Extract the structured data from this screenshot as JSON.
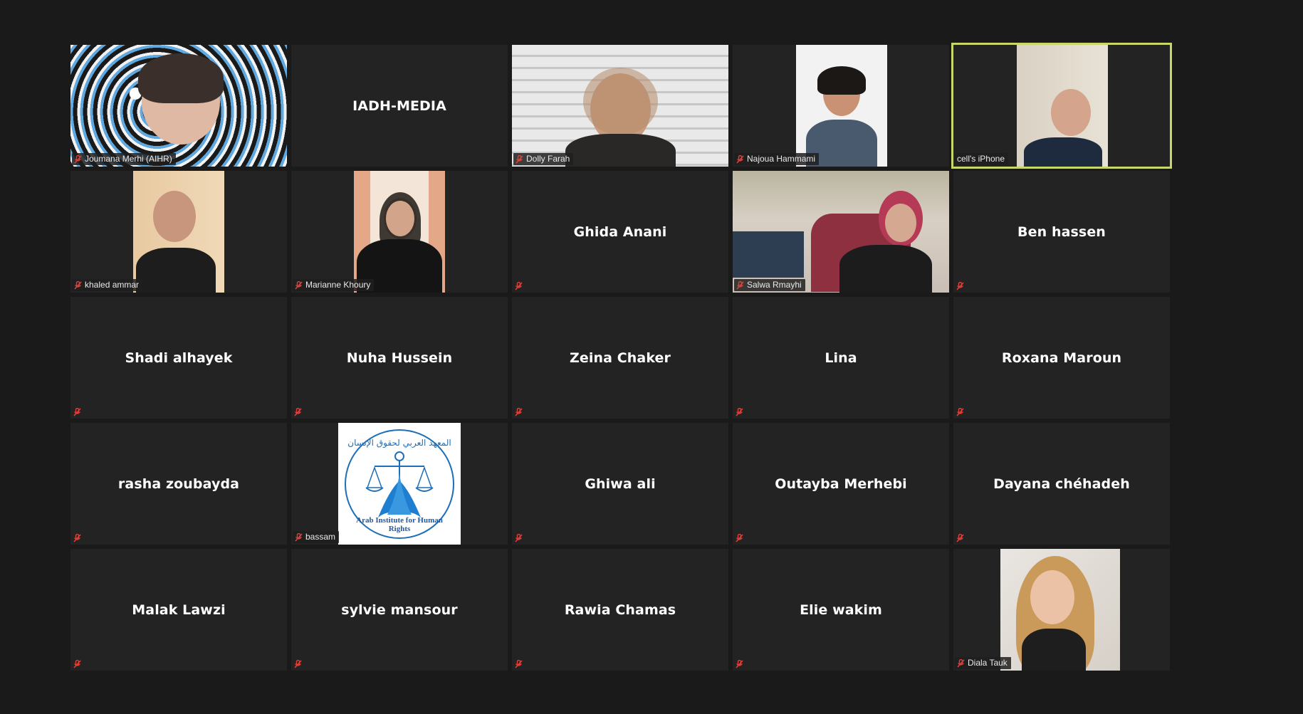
{
  "meeting": {
    "view": "gallery",
    "colors": {
      "background": "#1a1a1a",
      "tile": "#232323",
      "active_speaker_border": "#c8d66a",
      "muted_icon": "#e0403a"
    }
  },
  "participants": [
    {
      "name": "Joumana Merhi (AIHR)",
      "video": true,
      "muted": true,
      "active": false
    },
    {
      "name": "IADH-MEDIA",
      "video": false,
      "muted": false,
      "active": false
    },
    {
      "name": "Dolly Farah",
      "video": true,
      "muted": true,
      "active": false
    },
    {
      "name": "Najoua Hammami",
      "video": true,
      "muted": true,
      "active": false
    },
    {
      "name": "cell's iPhone",
      "video": true,
      "muted": false,
      "active": true
    },
    {
      "name": "khaled ammar",
      "video": true,
      "muted": true,
      "active": false
    },
    {
      "name": "Marianne Khoury",
      "video": true,
      "muted": true,
      "active": false
    },
    {
      "name": "Ghida Anani",
      "video": false,
      "muted": true,
      "active": false
    },
    {
      "name": "Salwa Rmayhi",
      "video": true,
      "muted": true,
      "active": false
    },
    {
      "name": "Ben hassen",
      "video": false,
      "muted": true,
      "active": false
    },
    {
      "name": "Shadi alhayek",
      "video": false,
      "muted": true,
      "active": false
    },
    {
      "name": "Nuha Hussein",
      "video": false,
      "muted": true,
      "active": false
    },
    {
      "name": "Zeina Chaker",
      "video": false,
      "muted": true,
      "active": false
    },
    {
      "name": "Lina",
      "video": false,
      "muted": true,
      "active": false
    },
    {
      "name": "Roxana Maroun",
      "video": false,
      "muted": true,
      "active": false
    },
    {
      "name": "rasha zoubayda",
      "video": false,
      "muted": true,
      "active": false
    },
    {
      "name": "bassam",
      "video": true,
      "muted": true,
      "active": false,
      "logo_text": "Arab Institute for Human Rights",
      "logo_arabic": "المعهد العربي لحقوق الإنسان"
    },
    {
      "name": "Ghiwa ali",
      "video": false,
      "muted": true,
      "active": false
    },
    {
      "name": "Outayba Merhebi",
      "video": false,
      "muted": true,
      "active": false
    },
    {
      "name": "Dayana chéhadeh",
      "video": false,
      "muted": true,
      "active": false
    },
    {
      "name": "Malak Lawzi",
      "video": false,
      "muted": true,
      "active": false
    },
    {
      "name": "sylvie mansour",
      "video": false,
      "muted": true,
      "active": false
    },
    {
      "name": "Rawia Chamas",
      "video": false,
      "muted": true,
      "active": false
    },
    {
      "name": "Elie wakim",
      "video": false,
      "muted": true,
      "active": false
    },
    {
      "name": "Diala Tauk",
      "video": true,
      "muted": true,
      "active": false
    }
  ]
}
